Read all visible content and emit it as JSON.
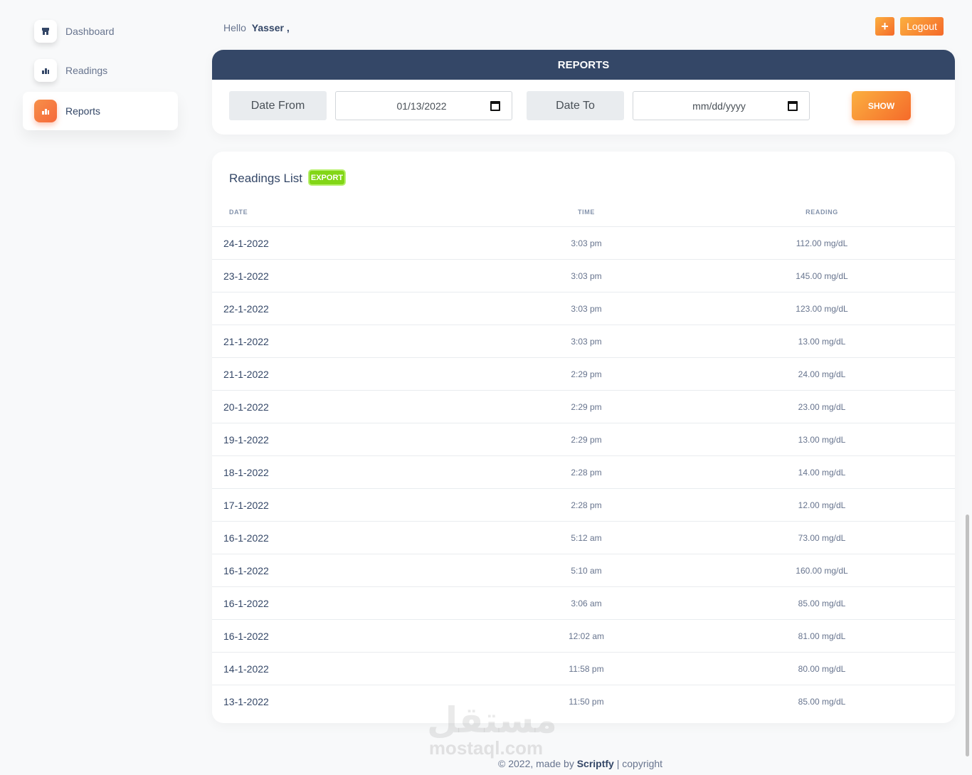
{
  "sidebar": {
    "items": [
      {
        "label": "Dashboard",
        "icon": "store-icon",
        "active": false
      },
      {
        "label": "Readings",
        "icon": "chart-icon",
        "active": false
      },
      {
        "label": "Reports",
        "icon": "chart-icon",
        "active": true
      }
    ]
  },
  "header": {
    "greeting": "Hello",
    "username": "Yasser ,",
    "plus_label": "+",
    "logout_label": "Logout"
  },
  "reports": {
    "title": "REPORTS",
    "date_from_label": "Date From",
    "date_from_value": "01/13/2022",
    "date_to_label": "Date To",
    "date_to_value": "mm/dd/yyyy",
    "show_label": "SHOW"
  },
  "readings": {
    "title": "Readings List",
    "export_label": "EXPORT",
    "columns": [
      "DATE",
      "TIME",
      "READING"
    ],
    "rows": [
      {
        "date": "24-1-2022",
        "time": "3:03 pm",
        "reading": "112.00 mg/dL"
      },
      {
        "date": "23-1-2022",
        "time": "3:03 pm",
        "reading": "145.00 mg/dL"
      },
      {
        "date": "22-1-2022",
        "time": "3:03 pm",
        "reading": "123.00 mg/dL"
      },
      {
        "date": "21-1-2022",
        "time": "3:03 pm",
        "reading": "13.00 mg/dL"
      },
      {
        "date": "21-1-2022",
        "time": "2:29 pm",
        "reading": "24.00 mg/dL"
      },
      {
        "date": "20-1-2022",
        "time": "2:29 pm",
        "reading": "23.00 mg/dL"
      },
      {
        "date": "19-1-2022",
        "time": "2:29 pm",
        "reading": "13.00 mg/dL"
      },
      {
        "date": "18-1-2022",
        "time": "2:28 pm",
        "reading": "14.00 mg/dL"
      },
      {
        "date": "17-1-2022",
        "time": "2:28 pm",
        "reading": "12.00 mg/dL"
      },
      {
        "date": "16-1-2022",
        "time": "5:12 am",
        "reading": "73.00 mg/dL"
      },
      {
        "date": "16-1-2022",
        "time": "5:10 am",
        "reading": "160.00 mg/dL"
      },
      {
        "date": "16-1-2022",
        "time": "3:06 am",
        "reading": "85.00 mg/dL"
      },
      {
        "date": "16-1-2022",
        "time": "12:02 am",
        "reading": "81.00 mg/dL"
      },
      {
        "date": "14-1-2022",
        "time": "11:58 pm",
        "reading": "80.00 mg/dL"
      },
      {
        "date": "13-1-2022",
        "time": "11:50 pm",
        "reading": "85.00 mg/dL"
      }
    ]
  },
  "watermark": {
    "arabic": "مستقل",
    "latin": "mostaql.com"
  },
  "footer": {
    "prefix": "© 2022, made by",
    "brand": "Scriptfy",
    "suffix": "| copyright"
  },
  "colors": {
    "accent": "#f56a2a",
    "header": "#344767",
    "export": "#82d616"
  }
}
